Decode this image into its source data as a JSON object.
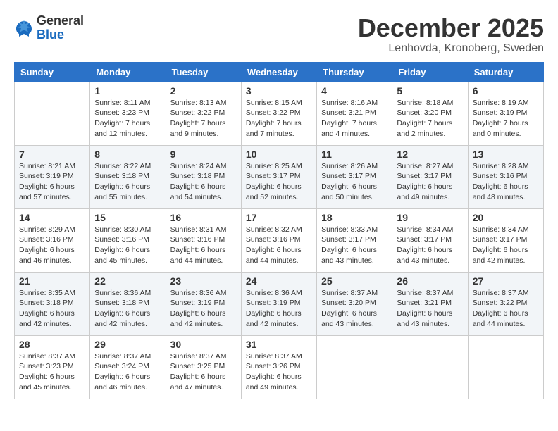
{
  "logo": {
    "general": "General",
    "blue": "Blue"
  },
  "header": {
    "month": "December 2025",
    "location": "Lenhovda, Kronoberg, Sweden"
  },
  "days_of_week": [
    "Sunday",
    "Monday",
    "Tuesday",
    "Wednesday",
    "Thursday",
    "Friday",
    "Saturday"
  ],
  "weeks": [
    [
      {
        "day": "",
        "info": ""
      },
      {
        "day": "1",
        "info": "Sunrise: 8:11 AM\nSunset: 3:23 PM\nDaylight: 7 hours\nand 12 minutes."
      },
      {
        "day": "2",
        "info": "Sunrise: 8:13 AM\nSunset: 3:22 PM\nDaylight: 7 hours\nand 9 minutes."
      },
      {
        "day": "3",
        "info": "Sunrise: 8:15 AM\nSunset: 3:22 PM\nDaylight: 7 hours\nand 7 minutes."
      },
      {
        "day": "4",
        "info": "Sunrise: 8:16 AM\nSunset: 3:21 PM\nDaylight: 7 hours\nand 4 minutes."
      },
      {
        "day": "5",
        "info": "Sunrise: 8:18 AM\nSunset: 3:20 PM\nDaylight: 7 hours\nand 2 minutes."
      },
      {
        "day": "6",
        "info": "Sunrise: 8:19 AM\nSunset: 3:19 PM\nDaylight: 7 hours\nand 0 minutes."
      }
    ],
    [
      {
        "day": "7",
        "info": "Sunrise: 8:21 AM\nSunset: 3:19 PM\nDaylight: 6 hours\nand 57 minutes."
      },
      {
        "day": "8",
        "info": "Sunrise: 8:22 AM\nSunset: 3:18 PM\nDaylight: 6 hours\nand 55 minutes."
      },
      {
        "day": "9",
        "info": "Sunrise: 8:24 AM\nSunset: 3:18 PM\nDaylight: 6 hours\nand 54 minutes."
      },
      {
        "day": "10",
        "info": "Sunrise: 8:25 AM\nSunset: 3:17 PM\nDaylight: 6 hours\nand 52 minutes."
      },
      {
        "day": "11",
        "info": "Sunrise: 8:26 AM\nSunset: 3:17 PM\nDaylight: 6 hours\nand 50 minutes."
      },
      {
        "day": "12",
        "info": "Sunrise: 8:27 AM\nSunset: 3:17 PM\nDaylight: 6 hours\nand 49 minutes."
      },
      {
        "day": "13",
        "info": "Sunrise: 8:28 AM\nSunset: 3:16 PM\nDaylight: 6 hours\nand 48 minutes."
      }
    ],
    [
      {
        "day": "14",
        "info": "Sunrise: 8:29 AM\nSunset: 3:16 PM\nDaylight: 6 hours\nand 46 minutes."
      },
      {
        "day": "15",
        "info": "Sunrise: 8:30 AM\nSunset: 3:16 PM\nDaylight: 6 hours\nand 45 minutes."
      },
      {
        "day": "16",
        "info": "Sunrise: 8:31 AM\nSunset: 3:16 PM\nDaylight: 6 hours\nand 44 minutes."
      },
      {
        "day": "17",
        "info": "Sunrise: 8:32 AM\nSunset: 3:16 PM\nDaylight: 6 hours\nand 44 minutes."
      },
      {
        "day": "18",
        "info": "Sunrise: 8:33 AM\nSunset: 3:17 PM\nDaylight: 6 hours\nand 43 minutes."
      },
      {
        "day": "19",
        "info": "Sunrise: 8:34 AM\nSunset: 3:17 PM\nDaylight: 6 hours\nand 43 minutes."
      },
      {
        "day": "20",
        "info": "Sunrise: 8:34 AM\nSunset: 3:17 PM\nDaylight: 6 hours\nand 42 minutes."
      }
    ],
    [
      {
        "day": "21",
        "info": "Sunrise: 8:35 AM\nSunset: 3:18 PM\nDaylight: 6 hours\nand 42 minutes."
      },
      {
        "day": "22",
        "info": "Sunrise: 8:36 AM\nSunset: 3:18 PM\nDaylight: 6 hours\nand 42 minutes."
      },
      {
        "day": "23",
        "info": "Sunrise: 8:36 AM\nSunset: 3:19 PM\nDaylight: 6 hours\nand 42 minutes."
      },
      {
        "day": "24",
        "info": "Sunrise: 8:36 AM\nSunset: 3:19 PM\nDaylight: 6 hours\nand 42 minutes."
      },
      {
        "day": "25",
        "info": "Sunrise: 8:37 AM\nSunset: 3:20 PM\nDaylight: 6 hours\nand 43 minutes."
      },
      {
        "day": "26",
        "info": "Sunrise: 8:37 AM\nSunset: 3:21 PM\nDaylight: 6 hours\nand 43 minutes."
      },
      {
        "day": "27",
        "info": "Sunrise: 8:37 AM\nSunset: 3:22 PM\nDaylight: 6 hours\nand 44 minutes."
      }
    ],
    [
      {
        "day": "28",
        "info": "Sunrise: 8:37 AM\nSunset: 3:23 PM\nDaylight: 6 hours\nand 45 minutes."
      },
      {
        "day": "29",
        "info": "Sunrise: 8:37 AM\nSunset: 3:24 PM\nDaylight: 6 hours\nand 46 minutes."
      },
      {
        "day": "30",
        "info": "Sunrise: 8:37 AM\nSunset: 3:25 PM\nDaylight: 6 hours\nand 47 minutes."
      },
      {
        "day": "31",
        "info": "Sunrise: 8:37 AM\nSunset: 3:26 PM\nDaylight: 6 hours\nand 49 minutes."
      },
      {
        "day": "",
        "info": ""
      },
      {
        "day": "",
        "info": ""
      },
      {
        "day": "",
        "info": ""
      }
    ]
  ]
}
